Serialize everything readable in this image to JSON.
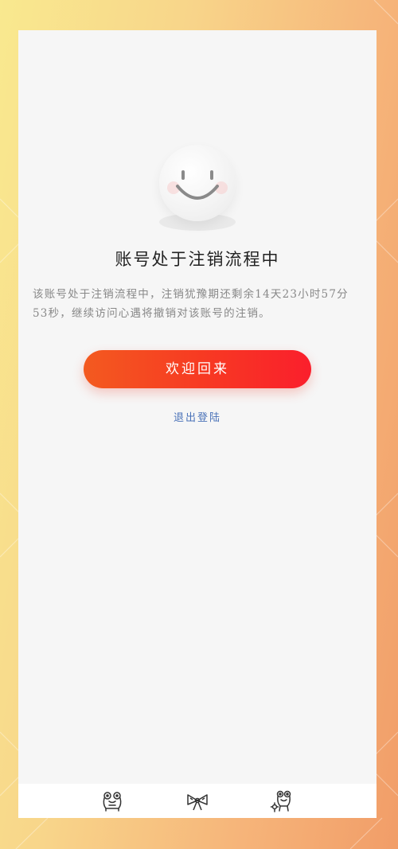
{
  "account_status": {
    "title": "账号处于注销流程中",
    "description": "该账号处于注销流程中，注销犹豫期还剩余14天23小时57分53秒，继续访问心遇将撤销对该账号的注销。",
    "primary_button_label": "欢迎回来",
    "secondary_link_label": "退出登陆"
  },
  "icons": {
    "illustration": "smiley-face-icon",
    "tabs": [
      "frog-icon",
      "bow-icon",
      "frog-with-flower-icon"
    ]
  },
  "colors": {
    "primary_start": "#f35a20",
    "primary_end": "#fa1f2c",
    "link": "#4a72b8",
    "background_start": "#f9e98f",
    "background_end": "#f19d68"
  }
}
